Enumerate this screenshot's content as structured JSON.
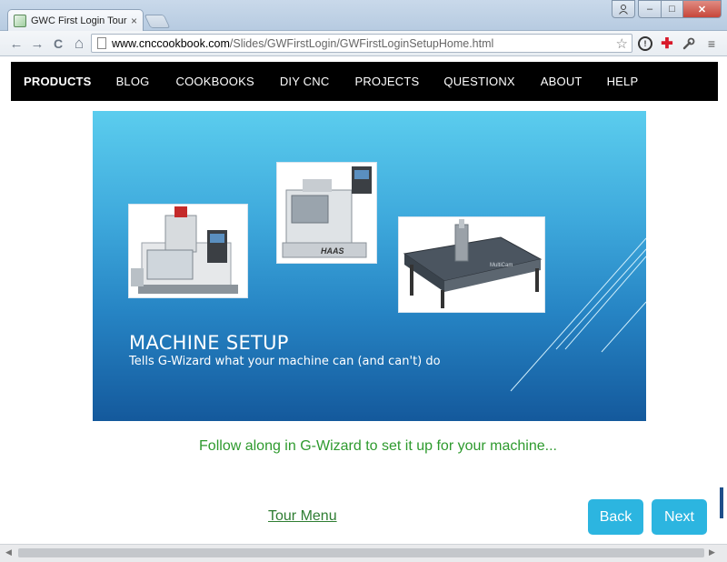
{
  "window": {
    "tab_title": "GWC First Login Tour: Set",
    "tab_close": "×",
    "user_icon": "user-icon",
    "min_glyph": "–",
    "max_glyph": "□",
    "close_glyph": "✕"
  },
  "toolbar": {
    "back_glyph": "←",
    "forward_glyph": "→",
    "reload_glyph": "C",
    "home_glyph": "⌂",
    "url_host": "www.cnccookbook.com",
    "url_path": "/Slides/GWFirstLogin/GWFirstLoginSetupHome.html",
    "star_glyph": "☆",
    "info_glyph": "!",
    "ext_glyph": "✚",
    "wrench_glyph": "🔧",
    "menu_glyph": "≡"
  },
  "site_nav": {
    "items": [
      {
        "label": "PRODUCTS",
        "bold": true
      },
      {
        "label": "BLOG"
      },
      {
        "label": "COOKBOOKS"
      },
      {
        "label": "DIY CNC"
      },
      {
        "label": "PROJECTS"
      },
      {
        "label": "QUESTIONX"
      },
      {
        "label": "ABOUT"
      },
      {
        "label": "HELP"
      }
    ]
  },
  "slide": {
    "title": "MACHINE SETUP",
    "subtitle": "Tells G-Wizard what your machine can (and can't) do",
    "lathe_badge": "HAAS",
    "router_badge": "MultiCam"
  },
  "main": {
    "follow_text": "Follow along in G-Wizard to set it up for your machine...",
    "tour_menu": "Tour Menu",
    "back_label": "Back",
    "next_label": "Next"
  },
  "colors": {
    "accent_button": "#2cb5e0",
    "follow_text": "#2e9a2e",
    "nav_bg": "#000000"
  }
}
